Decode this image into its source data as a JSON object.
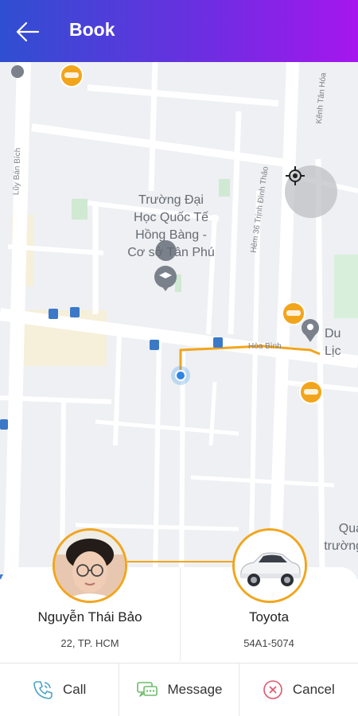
{
  "header": {
    "title": "Book"
  },
  "map": {
    "poi_school": "Trường Đại\nHọc Quốc Tế\nHồng Bàng -\nCơ sở Tân Phú",
    "poi_travel": "Du Lịc",
    "poi_qua": "Quả\ntrường",
    "roads": {
      "luy_ban_bich": "Lũy Bán Bích",
      "kenh_tan_hoa": "Kênh Tân Hóa",
      "hem_36": "Hẻm 36 Trịnh Đình Thảo",
      "hoa_binh": "Hòa Bình"
    }
  },
  "driver": {
    "name": "Nguyễn Thái Bảo",
    "sub": "22, TP. HCM"
  },
  "car": {
    "name": "Toyota",
    "plate": "54A1-5074"
  },
  "actions": {
    "call": "Call",
    "message": "Message",
    "cancel": "Cancel"
  },
  "colors": {
    "accent": "#f2a51c",
    "route": "#f2a51c",
    "header_start": "#2f4fd1",
    "header_end": "#a616ee"
  }
}
